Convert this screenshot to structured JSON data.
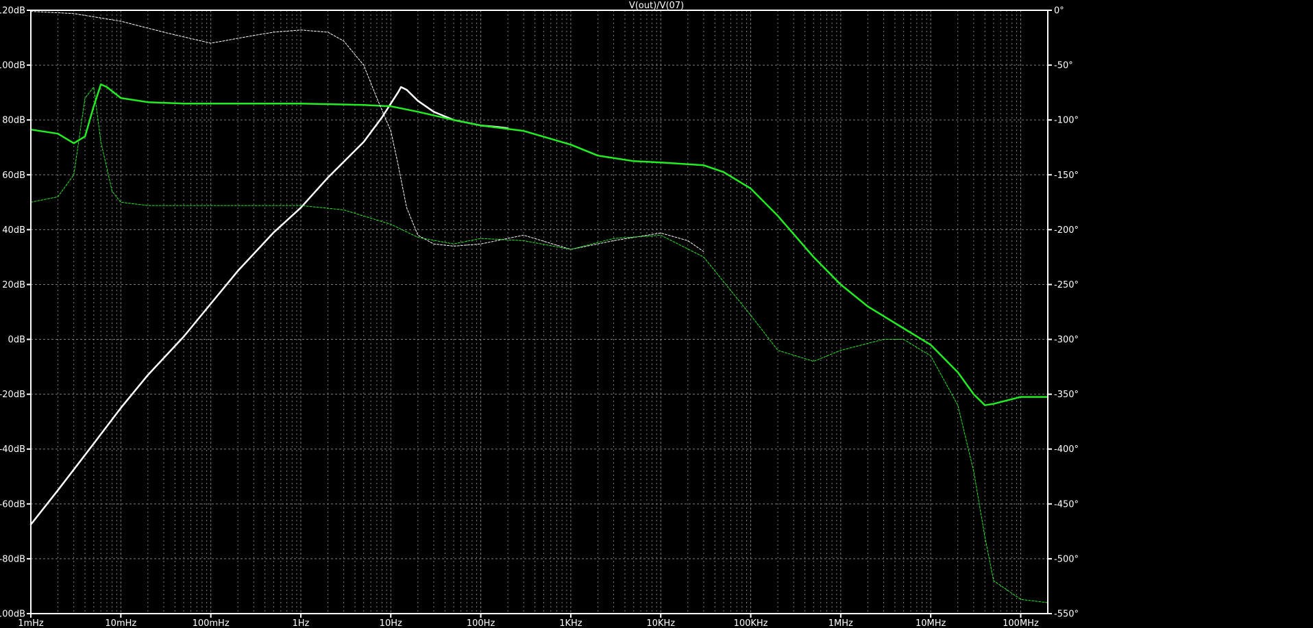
{
  "chart_data": {
    "type": "line",
    "title": "V(out)/V(07)",
    "x_scale": "log",
    "xlim": [
      0.001,
      200000000
    ],
    "ylim_left": [
      -100,
      120
    ],
    "ylim_right": [
      -550,
      0
    ],
    "x_ticks": [
      {
        "value": 0.001,
        "label": "1mHz"
      },
      {
        "value": 0.01,
        "label": "10mHz"
      },
      {
        "value": 0.1,
        "label": "100mHz"
      },
      {
        "value": 1,
        "label": "1Hz"
      },
      {
        "value": 10,
        "label": "10Hz"
      },
      {
        "value": 100,
        "label": "100Hz"
      },
      {
        "value": 1000,
        "label": "1KHz"
      },
      {
        "value": 10000,
        "label": "10KHz"
      },
      {
        "value": 100000,
        "label": "100KHz"
      },
      {
        "value": 1000000,
        "label": "1MHz"
      },
      {
        "value": 10000000,
        "label": "10MHz"
      },
      {
        "value": 100000000,
        "label": "100MHz"
      }
    ],
    "y_left_ticks": [
      {
        "value": 120,
        "label": "120dB"
      },
      {
        "value": 100,
        "label": "100dB"
      },
      {
        "value": 80,
        "label": "80dB"
      },
      {
        "value": 60,
        "label": "60dB"
      },
      {
        "value": 40,
        "label": "40dB"
      },
      {
        "value": 20,
        "label": "20dB"
      },
      {
        "value": 0,
        "label": "0dB"
      },
      {
        "value": -20,
        "label": "-20dB"
      },
      {
        "value": -40,
        "label": "-40dB"
      },
      {
        "value": -60,
        "label": "-60dB"
      },
      {
        "value": -80,
        "label": "-80dB"
      },
      {
        "value": -100,
        "label": "-100dB"
      }
    ],
    "y_right_ticks": [
      {
        "value": 0,
        "label": "0°"
      },
      {
        "value": -50,
        "label": "-50°"
      },
      {
        "value": -100,
        "label": "-100°"
      },
      {
        "value": -150,
        "label": "-150°"
      },
      {
        "value": -200,
        "label": "-200°"
      },
      {
        "value": -250,
        "label": "-250°"
      },
      {
        "value": -300,
        "label": "-300°"
      },
      {
        "value": -350,
        "label": "-350°"
      },
      {
        "value": -400,
        "label": "-400°"
      },
      {
        "value": -450,
        "label": "-450°"
      },
      {
        "value": -500,
        "label": "-500°"
      },
      {
        "value": -550,
        "label": "-550°"
      }
    ],
    "grid": true,
    "colors": {
      "background": "#000000",
      "axis": "#ffffff",
      "grid": "#7f7f7f",
      "white_trace": "#ffffff",
      "green_trace": "#22ee22"
    },
    "series": [
      {
        "axis": "left",
        "color": "#ffffff",
        "style": "solid",
        "x": [
          0.001,
          0.002,
          0.005,
          0.01,
          0.02,
          0.05,
          0.1,
          0.2,
          0.5,
          1,
          2,
          5,
          8,
          10,
          12,
          13,
          15,
          20,
          30,
          50,
          100,
          150,
          200
        ],
        "y": [
          -67.5,
          -55,
          -38,
          -25,
          -13,
          1,
          13,
          25,
          39,
          48,
          59,
          72,
          81,
          86,
          90,
          92,
          91,
          87,
          83,
          80,
          78,
          77.5,
          77
        ]
      },
      {
        "axis": "left",
        "color": "#22ee22",
        "style": "solid",
        "x": [
          0.001,
          0.002,
          0.003,
          0.004,
          0.005,
          0.006,
          0.007,
          0.01,
          0.02,
          0.05,
          0.1,
          1,
          5,
          10,
          20,
          50,
          100,
          300,
          1000,
          2000,
          5000,
          10000,
          30000,
          50000,
          100000,
          200000,
          500000,
          1000000,
          2000000,
          5000000,
          10000000,
          20000000,
          30000000,
          40000000,
          50000000,
          100000000,
          200000000
        ],
        "y": [
          76.5,
          75,
          71.5,
          74,
          85,
          93,
          92,
          88,
          86.5,
          86,
          86,
          86,
          85.5,
          85,
          83,
          80,
          78,
          76,
          71,
          67,
          65,
          64.5,
          63.5,
          61,
          55,
          45,
          30,
          20,
          12,
          4,
          -2,
          -12,
          -20,
          -24,
          -23.5,
          -21,
          -21
        ]
      },
      {
        "axis": "right",
        "color": "#ffffff",
        "style": "dashed",
        "x": [
          0.001,
          0.003,
          0.01,
          0.03,
          0.1,
          0.3,
          0.5,
          1,
          2,
          3,
          5,
          7,
          10,
          12,
          15,
          20,
          30,
          50,
          100,
          300,
          1000,
          3000,
          10000,
          20000,
          30000
        ],
        "y": [
          -1,
          -3,
          -10,
          -20,
          -30,
          -23,
          -20,
          -18,
          -20,
          -28,
          -50,
          -80,
          -110,
          -140,
          -180,
          -205,
          -213,
          -215,
          -213,
          -205,
          -218,
          -210,
          -203,
          -210,
          -220
        ]
      },
      {
        "axis": "right",
        "color": "#22ee22",
        "style": "dashed",
        "x": [
          0.001,
          0.002,
          0.003,
          0.004,
          0.005,
          0.006,
          0.008,
          0.01,
          0.02,
          0.05,
          0.1,
          1,
          3,
          10,
          20,
          50,
          100,
          300,
          1000,
          3000,
          10000,
          30000,
          100000,
          200000,
          500000,
          1000000,
          3000000,
          5000000,
          10000000,
          20000000,
          30000000,
          40000000,
          50000000,
          100000000,
          200000000
        ],
        "y": [
          -175,
          -170,
          -150,
          -80,
          -70,
          -120,
          -165,
          -175,
          -178,
          -178,
          -178,
          -178,
          -182,
          -195,
          -207,
          -213,
          -208,
          -210,
          -218,
          -208,
          -205,
          -225,
          -278,
          -310,
          -320,
          -310,
          -300,
          -300,
          -315,
          -360,
          -420,
          -480,
          -520,
          -537,
          -540
        ]
      }
    ]
  }
}
